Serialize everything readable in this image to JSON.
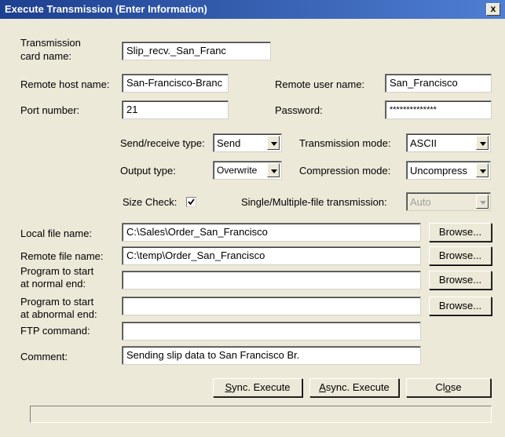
{
  "window": {
    "title": "Execute Transmission (Enter Information)",
    "close_glyph": "x"
  },
  "card_name": {
    "label_line1": "Transmission",
    "label_line2": "card name:",
    "value": "Slip_recv._San_Franc"
  },
  "remote_host": {
    "label": "Remote host name:",
    "value": "San-Francisco-Branc"
  },
  "remote_user": {
    "label": "Remote user name:",
    "value": "San_Francisco"
  },
  "port": {
    "label": "Port number:",
    "value": "21"
  },
  "password": {
    "label": "Password:",
    "value": "**************"
  },
  "send_receive": {
    "label": "Send/receive type:",
    "value": "Send"
  },
  "transmission_mode": {
    "label": "Transmission mode:",
    "value": "ASCII"
  },
  "output_type": {
    "label": "Output type:",
    "value": "Overwrite"
  },
  "compression_mode": {
    "label": "Compression mode:",
    "value": "Uncompress"
  },
  "size_check": {
    "label": "Size Check:",
    "checked": true
  },
  "single_multi": {
    "label": "Single/Multiple-file transmission:",
    "value": "Auto"
  },
  "local_file": {
    "label": "Local file name:",
    "value": "C:\\Sales\\Order_San_Francisco",
    "browse": "Browse..."
  },
  "remote_file": {
    "label": "Remote file name:",
    "value": "C:\\temp\\Order_San_Francisco",
    "browse": "Browse..."
  },
  "prog_normal": {
    "label_line1": "Program to start",
    "label_line2": "at normal end:",
    "value": "",
    "browse": "Browse..."
  },
  "prog_abnormal": {
    "label_line1": "Program to start",
    "label_line2": "at abnormal end:",
    "value": "",
    "browse": "Browse..."
  },
  "ftp_command": {
    "label": "FTP command:",
    "value": ""
  },
  "comment": {
    "label": "Comment:",
    "value": "Sending slip data to San Francisco Br."
  },
  "buttons": {
    "sync_pre": "",
    "sync_key": "S",
    "sync_post": "ync. Execute",
    "async_pre": "",
    "async_key": "A",
    "async_post": "sync. Execute",
    "close_pre": "Cl",
    "close_key": "o",
    "close_post": "se"
  },
  "status_text": ""
}
